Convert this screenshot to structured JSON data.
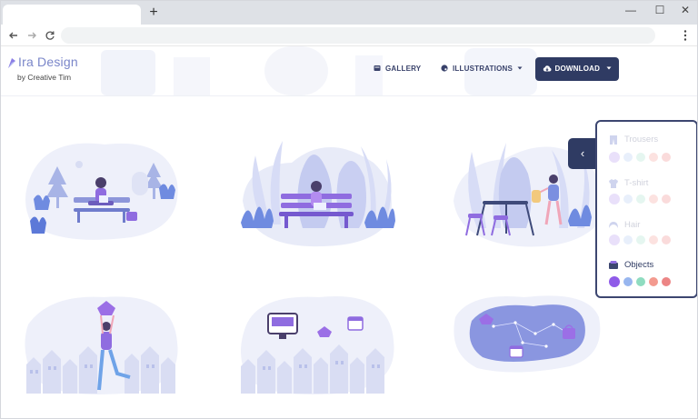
{
  "browser": {
    "new_tab_icon": "+",
    "window_controls": [
      "—",
      "☐",
      "✕"
    ],
    "nav_icons": [
      "back-arrow",
      "forward-arrow",
      "reload"
    ],
    "menu_icon": "kebab-menu"
  },
  "site": {
    "brand": "Ira Design",
    "byline": "by Creative Tim",
    "nav": {
      "gallery": "GALLERY",
      "illustrations": "ILLUSTRATIONS",
      "download": "DOWNLOAD"
    }
  },
  "panel": {
    "toggle_icon": "‹",
    "categories": [
      {
        "label": "Trousers",
        "active": false,
        "swatches": [
          "#c9b3f4",
          "#c7d9f6",
          "#bfeadb",
          "#f8b9b3",
          "#f4a6a6"
        ]
      },
      {
        "label": "T-shirt",
        "active": false,
        "swatches": [
          "#c9b3f4",
          "#c7d9f6",
          "#bfeadb",
          "#f8b9b3",
          "#f4a6a6"
        ]
      },
      {
        "label": "Hair",
        "active": false,
        "swatches": [
          "#c9b3f4",
          "#c7d9f6",
          "#bfeadb",
          "#f8b9b3",
          "#f4a6a6"
        ]
      },
      {
        "label": "Objects",
        "active": true,
        "swatches": [
          "#8f5be8",
          "#98b6ef",
          "#8fdcc0",
          "#f39a8f",
          "#ec8585"
        ]
      }
    ]
  },
  "colors": {
    "brand": "#7a86c9",
    "nav_text": "#39426b",
    "button_dark": "#2f3b63",
    "illustration_lavender": "#e9ecf8",
    "illustration_purple": "#8f6ce0",
    "illustration_blue": "#7b8fe0"
  },
  "gallery": [
    {
      "scene": "girl-on-park-bench-with-trees"
    },
    {
      "scene": "girl-on-bench-with-leaves"
    },
    {
      "scene": "table-chairs-and-person-with-lantern"
    },
    {
      "scene": "girl-jumping-over-town"
    },
    {
      "scene": "town-with-floating-objects"
    },
    {
      "scene": "constellation-with-shopping-bag"
    }
  ]
}
